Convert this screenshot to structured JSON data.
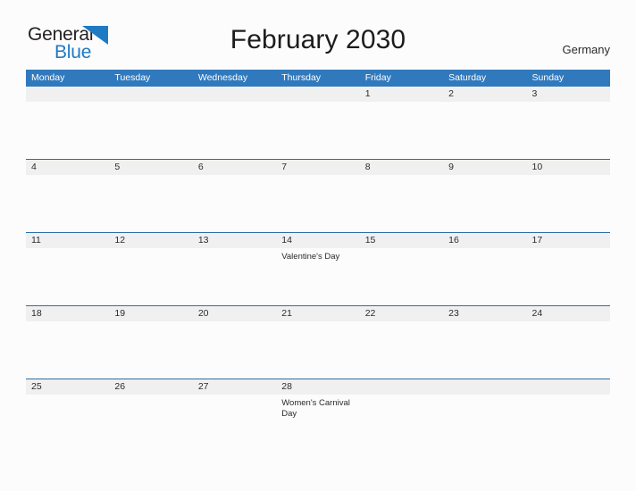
{
  "brand": {
    "name_part1": "General",
    "name_part2": "Blue",
    "flag_icon": "blue-triangle-flag-icon",
    "dark_color": "#231f20",
    "blue_color": "#1f7ac4"
  },
  "header": {
    "title": "February 2030",
    "region": "Germany"
  },
  "theme": {
    "header_blue": "#3179bd",
    "row_line_blue": "#2e6da4",
    "date_strip_gray": "#f0f0f0",
    "page_background": "#fcfcfc",
    "text_color": "#2b2b2b"
  },
  "calendar": {
    "month": "February",
    "year": "2030",
    "weekday_headers": [
      "Monday",
      "Tuesday",
      "Wednesday",
      "Thursday",
      "Friday",
      "Saturday",
      "Sunday"
    ],
    "weeks": [
      [
        {
          "day": "",
          "event": ""
        },
        {
          "day": "",
          "event": ""
        },
        {
          "day": "",
          "event": ""
        },
        {
          "day": "",
          "event": ""
        },
        {
          "day": "1",
          "event": ""
        },
        {
          "day": "2",
          "event": ""
        },
        {
          "day": "3",
          "event": ""
        }
      ],
      [
        {
          "day": "4",
          "event": ""
        },
        {
          "day": "5",
          "event": ""
        },
        {
          "day": "6",
          "event": ""
        },
        {
          "day": "7",
          "event": ""
        },
        {
          "day": "8",
          "event": ""
        },
        {
          "day": "9",
          "event": ""
        },
        {
          "day": "10",
          "event": ""
        }
      ],
      [
        {
          "day": "11",
          "event": ""
        },
        {
          "day": "12",
          "event": ""
        },
        {
          "day": "13",
          "event": ""
        },
        {
          "day": "14",
          "event": "Valentine's Day"
        },
        {
          "day": "15",
          "event": ""
        },
        {
          "day": "16",
          "event": ""
        },
        {
          "day": "17",
          "event": ""
        }
      ],
      [
        {
          "day": "18",
          "event": ""
        },
        {
          "day": "19",
          "event": ""
        },
        {
          "day": "20",
          "event": ""
        },
        {
          "day": "21",
          "event": ""
        },
        {
          "day": "22",
          "event": ""
        },
        {
          "day": "23",
          "event": ""
        },
        {
          "day": "24",
          "event": ""
        }
      ],
      [
        {
          "day": "25",
          "event": ""
        },
        {
          "day": "26",
          "event": ""
        },
        {
          "day": "27",
          "event": ""
        },
        {
          "day": "28",
          "event": "Women's Carnival Day"
        },
        {
          "day": "",
          "event": ""
        },
        {
          "day": "",
          "event": ""
        },
        {
          "day": "",
          "event": ""
        }
      ]
    ]
  }
}
